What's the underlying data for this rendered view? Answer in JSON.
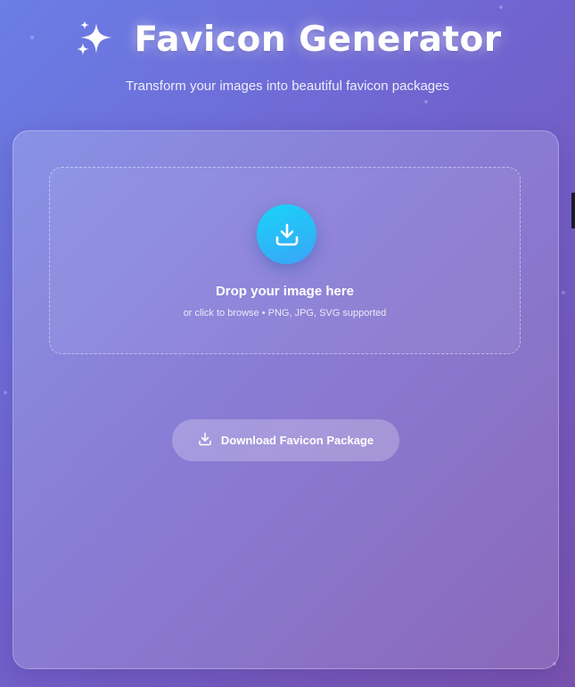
{
  "header": {
    "title": "Favicon Generator",
    "subtitle": "Transform your images into beautiful favicon packages",
    "icon": "sparkles-icon"
  },
  "dropzone": {
    "icon": "download-tray-icon",
    "title": "Drop your image here",
    "hint": "or click to browse • PNG, JPG, SVG supported"
  },
  "download_button": {
    "icon": "download-icon",
    "label": "Download Favicon Package"
  },
  "colors": {
    "background_start": "#6a7ee6",
    "background_end": "#7a52ae",
    "upload_icon_circle": "#18d4f7",
    "text": "#ffffff"
  }
}
